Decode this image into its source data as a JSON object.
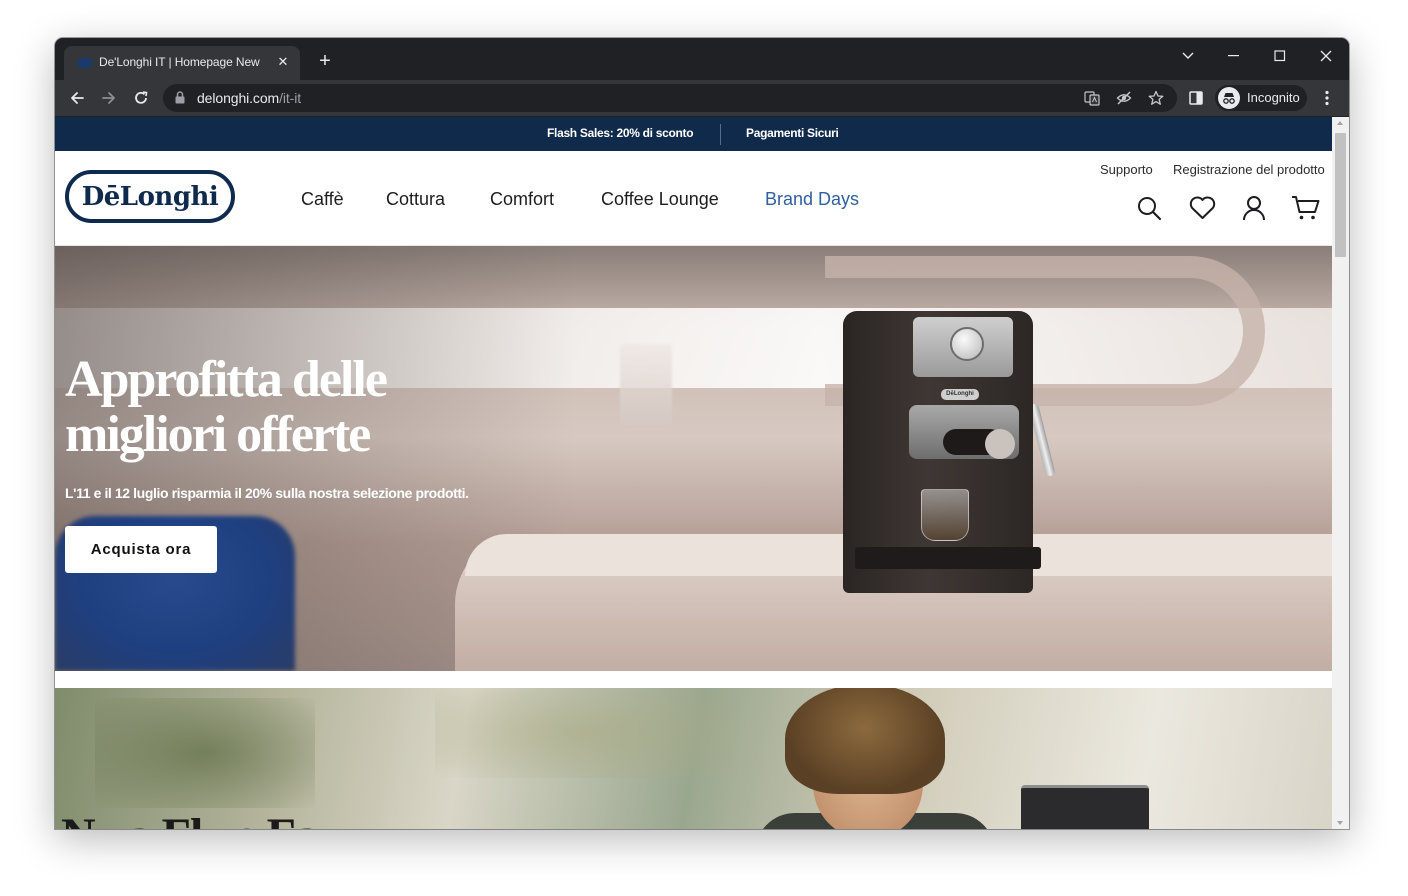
{
  "browser": {
    "tab_title": "De'Longhi IT | Homepage New",
    "url_host": "delonghi.com",
    "url_path": "/it-it",
    "profile_label": "Incognito"
  },
  "promo_bar": {
    "items": [
      "Flash Sales: 20% di sconto",
      "Pagamenti Sicuri"
    ]
  },
  "header": {
    "logo_text": "DēLonghi",
    "utility_links": [
      "Supporto",
      "Registrazione del prodotto"
    ],
    "nav": [
      "Caffè",
      "Cottura",
      "Comfort",
      "Coffee Lounge",
      "Brand Days"
    ],
    "active_nav": "Brand Days",
    "icons": [
      "search-icon",
      "heart-icon",
      "user-icon",
      "cart-icon"
    ]
  },
  "hero": {
    "title": "Approfitta delle\nmigliori offerte",
    "subtitle": "L'11 e il 12 luglio risparmia il 20% sulla nostra selezione prodotti.",
    "cta_label": "Acquista ora",
    "machine_badge": "DēLonghi"
  },
  "banner2": {
    "headline_partial": "N...a Fl...e Fa..."
  },
  "colors": {
    "brand_navy": "#102a4c",
    "nav_active": "#2f5f9e",
    "chrome_dark": "#202124",
    "chrome_toolbar": "#35363a"
  }
}
